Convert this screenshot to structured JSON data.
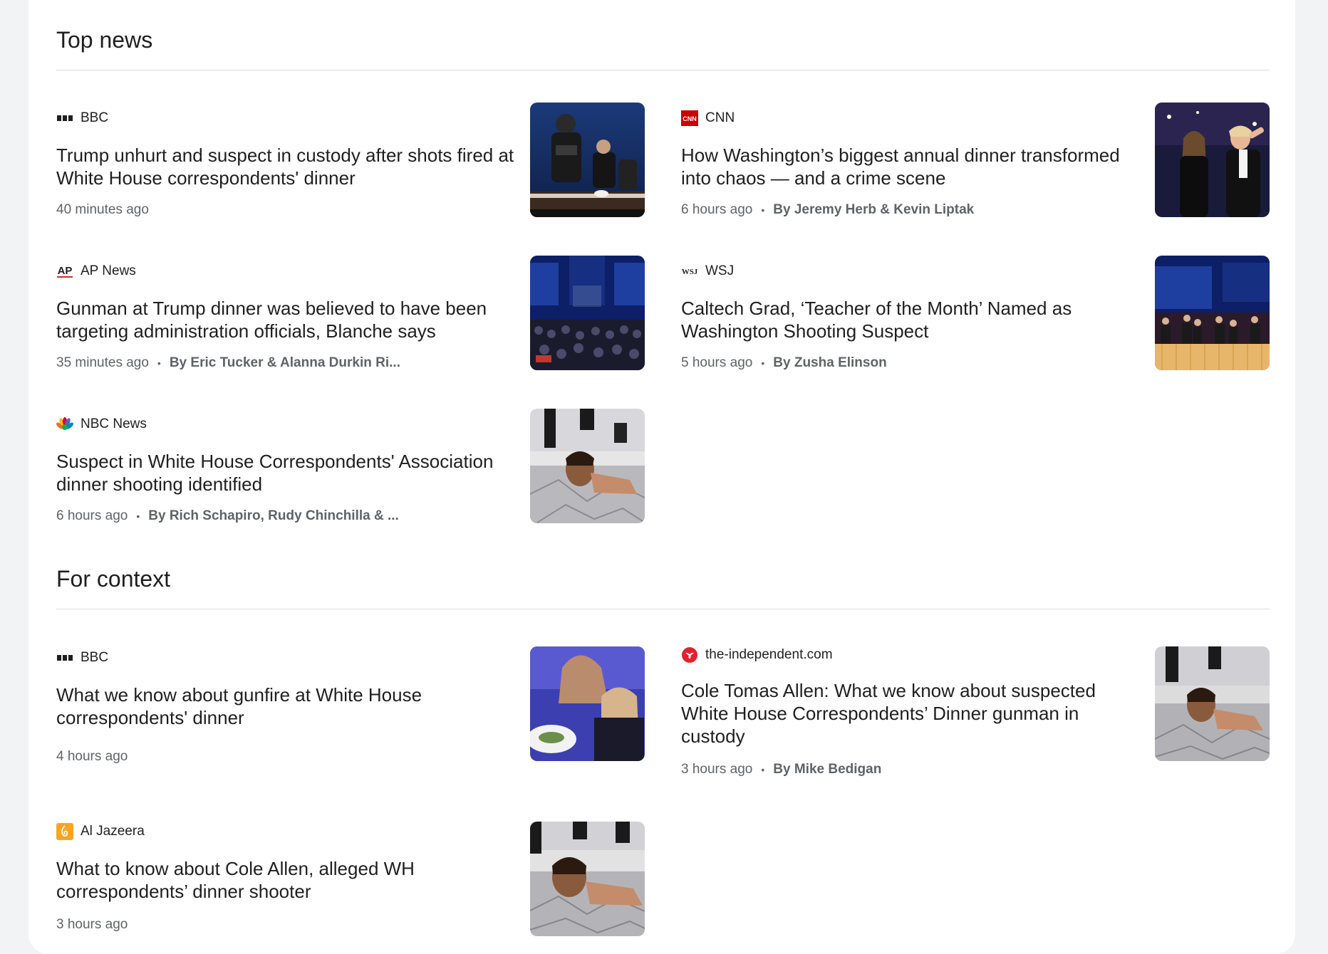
{
  "sections": [
    {
      "title": "Top news",
      "articles": [
        {
          "source": "BBC",
          "logo": "bbc-logo",
          "headline": "Trump unhurt and suspect in custody after shots fired at White House correspondents' dinner",
          "time": "40 minutes ago",
          "byline": ""
        },
        {
          "source": "CNN",
          "logo": "cnn-logo",
          "headline": "How Washington’s biggest annual dinner transformed into chaos — and a crime scene",
          "time": "6 hours ago",
          "byline": "By Jeremy Herb & Kevin Liptak"
        },
        {
          "source": "AP News",
          "logo": "ap-logo",
          "headline": "Gunman at Trump dinner was believed to have been targeting administration officials, Blanche says",
          "time": "35 minutes ago",
          "byline": "By Eric Tucker & Alanna Durkin Ri..."
        },
        {
          "source": "WSJ",
          "logo": "wsj-logo",
          "headline": "Caltech Grad, ‘Teacher of the Month’ Named as Washington Shooting Suspect",
          "time": "5 hours ago",
          "byline": "By Zusha Elinson"
        },
        {
          "source": "NBC News",
          "logo": "nbc-logo",
          "headline": "Suspect in White House Correspondents' Association dinner shooting identified",
          "time": "6 hours ago",
          "byline": "By Rich Schapiro, Rudy Chinchilla & ..."
        }
      ]
    },
    {
      "title": "For context",
      "articles": [
        {
          "source": "BBC",
          "logo": "bbc-logo",
          "headline": "What we know about gunfire at White House correspondents' dinner",
          "time": "4 hours ago",
          "byline": ""
        },
        {
          "source": "the-independent.com",
          "logo": "independent-logo",
          "headline": "Cole Tomas Allen: What we know about suspected White House Correspondents’ Dinner gunman in custody",
          "time": "3 hours ago",
          "byline": "By Mike Bedigan"
        },
        {
          "source": "Al Jazeera",
          "logo": "aljazeera-logo",
          "headline": "What to know about Cole Allen, alleged WH correspondents’ dinner shooter",
          "time": "3 hours ago",
          "byline": ""
        }
      ]
    }
  ],
  "colors": {
    "cnn_red": "#cc0000",
    "independent_red": "#e4202f",
    "aljazeera_orange": "#f6a623",
    "meta_gray": "#5f6368",
    "divider": "#dadce0"
  }
}
